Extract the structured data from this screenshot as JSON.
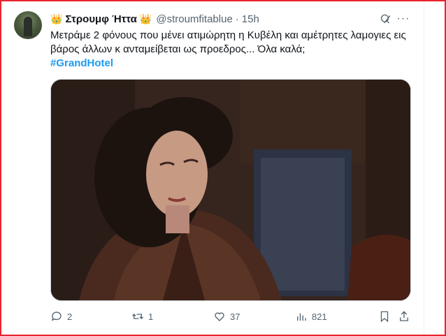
{
  "tweet": {
    "display_name": "Στρουμφ Ήττα",
    "name_emoji": "👑",
    "handle": "@stroumfitablue",
    "separator": "·",
    "time": "15h",
    "text": "Μετράμε 2 φόνους που μένει ατιμώρητη η Κυβέλη και αμέτρητες λαμογιες εις βάρος άλλων κ ανταμείβεται ως προεδρος... Όλα καλά;",
    "hashtag": "#GrandHotel",
    "more_label": "···"
  },
  "actions": {
    "replies": "2",
    "reposts": "1",
    "likes": "37",
    "views": "821"
  },
  "colors": {
    "accent": "#1d9bf0",
    "text": "#0f1419",
    "muted": "#536471",
    "frame": "#e8252f"
  },
  "icons": [
    "grok-icon",
    "more-icon",
    "reply-icon",
    "repost-icon",
    "like-icon",
    "views-icon",
    "bookmark-icon",
    "share-icon"
  ]
}
